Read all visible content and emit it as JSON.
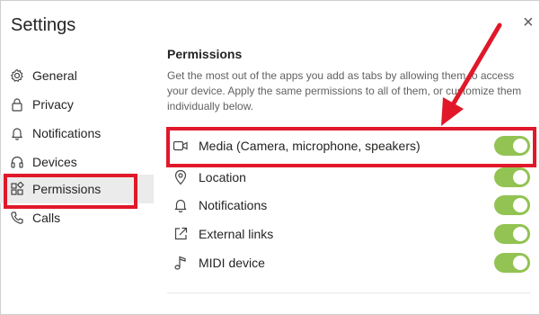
{
  "window": {
    "title": "Settings",
    "close_glyph": "×"
  },
  "sidebar": {
    "items": [
      {
        "label": "General",
        "icon": "gear-icon"
      },
      {
        "label": "Privacy",
        "icon": "lock-icon"
      },
      {
        "label": "Notifications",
        "icon": "bell-icon"
      },
      {
        "label": "Devices",
        "icon": "headset-icon"
      },
      {
        "label": "Permissions",
        "icon": "apps-icon",
        "active": true
      },
      {
        "label": "Calls",
        "icon": "phone-icon"
      }
    ]
  },
  "permissions": {
    "title": "Permissions",
    "description": "Get the most out of the apps you add as tabs by allowing them to access your device. Apply the same permissions to all of them, or customize them individually below.",
    "items": [
      {
        "label": "Media (Camera, microphone, speakers)",
        "icon": "camera-icon",
        "enabled": true
      },
      {
        "label": "Location",
        "icon": "location-icon",
        "enabled": true
      },
      {
        "label": "Notifications",
        "icon": "bell-icon",
        "enabled": true
      },
      {
        "label": "External links",
        "icon": "external-link-icon",
        "enabled": true
      },
      {
        "label": "MIDI device",
        "icon": "music-note-icon",
        "enabled": true
      }
    ]
  },
  "colors": {
    "toggle_on": "#92c353",
    "highlight": "#e0182a",
    "active_nav": "#ebebeb"
  }
}
